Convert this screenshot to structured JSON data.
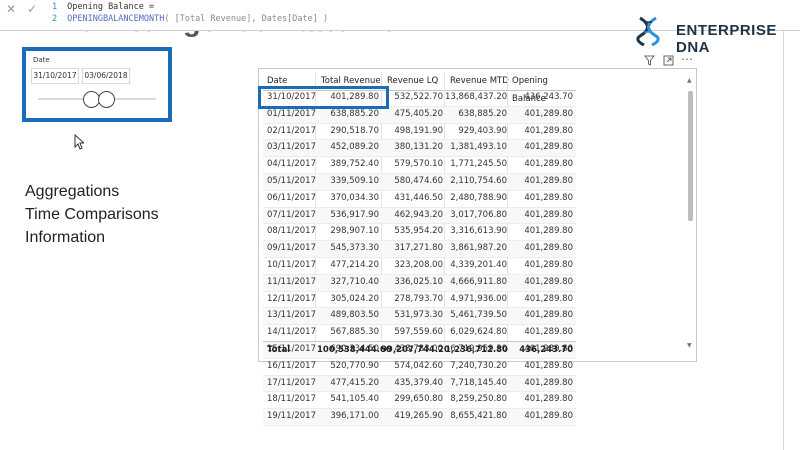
{
  "formula_bar": {
    "lines": [
      {
        "num": "1",
        "text": "Opening Balance ="
      },
      {
        "num": "2",
        "fn": "OPENINGBALANCEMONTH",
        "args": "( [Total Revenue], Dates[Date] )"
      }
    ]
  },
  "page_title": "Time Intelligence Patterns",
  "logo_text": "ENTERPRISE DNA",
  "slicer": {
    "title": "Date",
    "start_date": "31/10/2017",
    "end_date": "03/06/2018"
  },
  "categories": [
    "Aggregations",
    "Time Comparisons",
    "Information"
  ],
  "table": {
    "columns": [
      "Date",
      "Total Revenue",
      "Revenue LQ",
      "Revenue MTD",
      "Opening Balance"
    ],
    "rows": [
      [
        "31/10/2017",
        "401,289.80",
        "532,522.70",
        "13,868,437.20",
        "436,243.70"
      ],
      [
        "01/11/2017",
        "638,885.20",
        "475,405.20",
        "638,885.20",
        "401,289.80"
      ],
      [
        "02/11/2017",
        "290,518.70",
        "498,191.90",
        "929,403.90",
        "401,289.80"
      ],
      [
        "03/11/2017",
        "452,089.20",
        "380,131.20",
        "1,381,493.10",
        "401,289.80"
      ],
      [
        "04/11/2017",
        "389,752.40",
        "579,570.10",
        "1,771,245.50",
        "401,289.80"
      ],
      [
        "05/11/2017",
        "339,509.10",
        "580,474.60",
        "2,110,754.60",
        "401,289.80"
      ],
      [
        "06/11/2017",
        "370,034.30",
        "431,446.50",
        "2,480,788.90",
        "401,289.80"
      ],
      [
        "07/11/2017",
        "536,917.90",
        "462,943.20",
        "3,017,706.80",
        "401,289.80"
      ],
      [
        "08/11/2017",
        "298,907.10",
        "535,954.20",
        "3,316,613.90",
        "401,289.80"
      ],
      [
        "09/11/2017",
        "545,373.30",
        "317,271.80",
        "3,861,987.20",
        "401,289.80"
      ],
      [
        "10/11/2017",
        "477,214.20",
        "323,208.00",
        "4,339,201.40",
        "401,289.80"
      ],
      [
        "11/11/2017",
        "327,710.40",
        "336,025.10",
        "4,666,911.80",
        "401,289.80"
      ],
      [
        "12/11/2017",
        "305,024.20",
        "278,793.70",
        "4,971,936.00",
        "401,289.80"
      ],
      [
        "13/11/2017",
        "489,803.50",
        "531,973.30",
        "5,461,739.50",
        "401,289.80"
      ],
      [
        "14/11/2017",
        "567,885.30",
        "597,559.60",
        "6,029,624.80",
        "401,289.80"
      ],
      [
        "15/11/2017",
        "690,334.50",
        "438,783.00",
        "6,719,959.30",
        "401,289.80"
      ],
      [
        "16/11/2017",
        "520,770.90",
        "574,042.60",
        "7,240,730.20",
        "401,289.80"
      ],
      [
        "17/11/2017",
        "477,415.20",
        "435,379.40",
        "7,718,145.40",
        "401,289.80"
      ],
      [
        "18/11/2017",
        "541,105.40",
        "299,650.80",
        "8,259,250.80",
        "401,289.80"
      ],
      [
        "19/11/2017",
        "396,171.00",
        "419,265.90",
        "8,655,421.80",
        "401,289.80"
      ]
    ],
    "total": [
      "Total",
      "100,538,444.60",
      "99,207,744.20",
      "1,236,712.80",
      "436,243.70"
    ]
  },
  "colors": {
    "highlight": "#1a6bb8",
    "logo_dark": "#1f3347",
    "logo_accent": "#2f8fd8"
  },
  "icons": [
    "check-icon",
    "close-icon",
    "filter-icon",
    "focus-mode-icon",
    "more-options-icon",
    "cursor-icon"
  ]
}
